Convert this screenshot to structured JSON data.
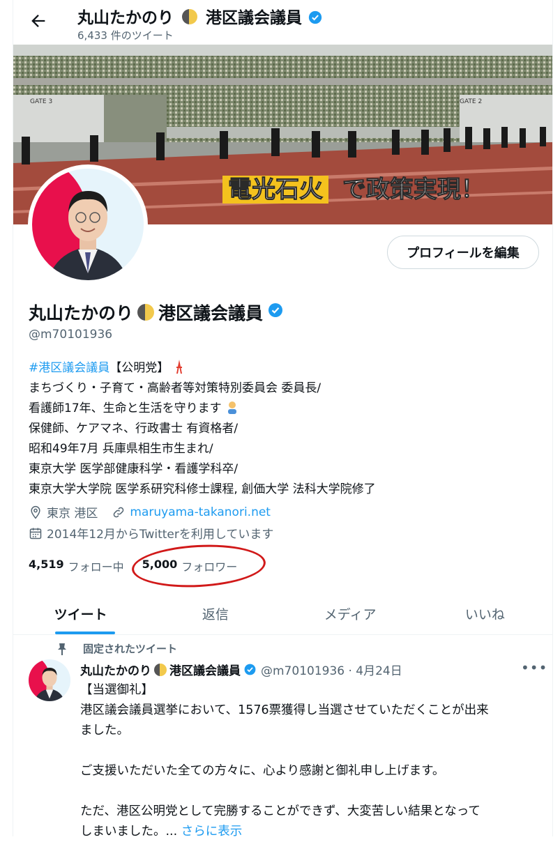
{
  "header": {
    "title_prefix": "丸山たかのり",
    "title_suffix": "港区議会議員",
    "tweet_count": "6,433 件のツイート"
  },
  "banner": {
    "slogan_highlight": "電光石火",
    "slogan_rest": "で政策実現！",
    "gate_left": "GATE 3",
    "gate_right": "GATE 2"
  },
  "profile": {
    "edit_button": "プロフィールを編集",
    "name_prefix": "丸山たかのり",
    "name_suffix": "港区議会議員",
    "handle": "@m70101936",
    "bio": {
      "hashtag": "#港区議会議員",
      "line1_rest": "【公明党】",
      "line2": "まちづくり・子育て・高齢者等対策特別委員会 委員長/",
      "line3": "看護師17年、生命と生活を守ります",
      "line4": "保健師、ケアマネ、行政書士 有資格者/",
      "line5": "昭和49年7月 兵庫県相生市生まれ/",
      "line6": "東京大学 医学部健康科学・看護学科卒/",
      "line7": "東京大学大学院 医学系研究科修士課程, 創価大学 法科大学院修了"
    },
    "location": "東京 港区",
    "website": "maruyama-takanori.net",
    "joined": "2014年12月からTwitterを利用しています",
    "following_count": "4,519",
    "following_label": "フォロー中",
    "followers_count": "5,000",
    "followers_label": "フォロワー"
  },
  "tabs": [
    {
      "label": "ツイート",
      "active": true
    },
    {
      "label": "返信",
      "active": false
    },
    {
      "label": "メディア",
      "active": false
    },
    {
      "label": "いいね",
      "active": false
    }
  ],
  "pinned": {
    "pinned_label": "固定されたツイート",
    "author_prefix": "丸山たかのり",
    "author_suffix": "港区議会議員",
    "handle_date": "@m70101936 · 4月24日",
    "lines": [
      "【当選御礼】",
      "港区議会議員選挙において、1576票獲得し当選させていただくことが出来",
      "ました。",
      "",
      "ご支援いただいた全ての方々に、心より感謝と御礼申し上げます。",
      "",
      "ただ、港区公明党として完勝することができず、大変苦しい結果となって",
      "しまいました。..."
    ],
    "more": "さらに表示"
  },
  "colors": {
    "accent": "#1d9bf0",
    "annotation_circle": "#d11919",
    "verified": "#1d9bf0",
    "banner_highlight": "#f4c21e"
  },
  "icons": [
    "back-arrow-icon",
    "moon-emoji-icon",
    "verified-badge-icon",
    "tokyo-tower-emoji-icon",
    "nurse-emoji-icon",
    "location-pin-icon",
    "link-icon",
    "calendar-icon",
    "pin-icon",
    "more-dots-icon"
  ]
}
